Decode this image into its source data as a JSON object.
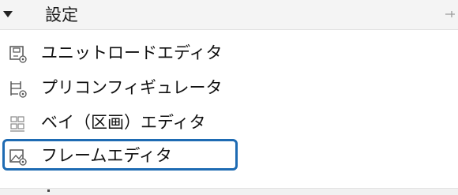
{
  "section": {
    "title": "設定",
    "expanded": true,
    "icon": "pin-icon"
  },
  "items": [
    {
      "label": "ユニットロードエディタ",
      "icon": "unit-load-editor-icon",
      "selected": false
    },
    {
      "label": "プリコンフィギュレータ",
      "icon": "preconfigurator-icon",
      "selected": false
    },
    {
      "label": "ベイ（区画）エディタ",
      "icon": "bay-editor-icon",
      "selected": false
    },
    {
      "label": "フレームエディタ",
      "icon": "frame-editor-icon",
      "selected": true
    }
  ],
  "colors": {
    "selection_border": "#1e6bb3",
    "header_background": "#f4f4f4",
    "icon_stroke": "#555555"
  }
}
